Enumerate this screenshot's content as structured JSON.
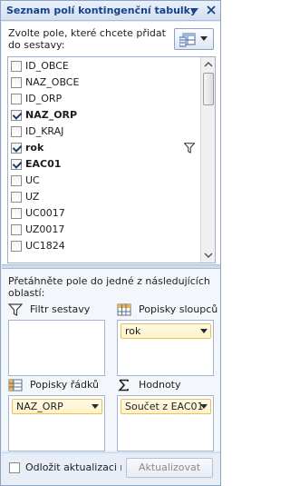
{
  "panel": {
    "title": "Seznam polí kontingenční tabulky"
  },
  "upper": {
    "instructions": "Zvolte pole, které chcete přidat do sestavy:",
    "layout_button_icon": "field-list-layout-icon"
  },
  "fields": [
    {
      "label": "ID_OBCE",
      "checked": false,
      "bold": false,
      "filtered": false
    },
    {
      "label": "NAZ_OBCE",
      "checked": false,
      "bold": false,
      "filtered": false
    },
    {
      "label": "ID_ORP",
      "checked": false,
      "bold": false,
      "filtered": false
    },
    {
      "label": "NAZ_ORP",
      "checked": true,
      "bold": true,
      "filtered": false
    },
    {
      "label": "ID_KRAJ",
      "checked": false,
      "bold": false,
      "filtered": false
    },
    {
      "label": "rok",
      "checked": true,
      "bold": true,
      "filtered": true
    },
    {
      "label": "EAC01",
      "checked": true,
      "bold": true,
      "filtered": false
    },
    {
      "label": "UC",
      "checked": false,
      "bold": false,
      "filtered": false
    },
    {
      "label": "UZ",
      "checked": false,
      "bold": false,
      "filtered": false
    },
    {
      "label": "UC0017",
      "checked": false,
      "bold": false,
      "filtered": false
    },
    {
      "label": "UZ0017",
      "checked": false,
      "bold": false,
      "filtered": false
    },
    {
      "label": "UC1824",
      "checked": false,
      "bold": false,
      "filtered": false
    }
  ],
  "lower": {
    "instructions": "Přetáhněte pole do jedné z následujících oblastí:",
    "areas": {
      "filter": {
        "label": "Filtr sestavy",
        "items": []
      },
      "columns": {
        "label": "Popisky sloupců",
        "items": [
          "rok"
        ]
      },
      "rows": {
        "label": "Popisky řádků",
        "items": [
          "NAZ_ORP"
        ]
      },
      "values": {
        "label": "Hodnoty",
        "items": [
          "Součet z EAC01"
        ]
      }
    }
  },
  "bottom": {
    "defer_label": "Odložit aktualizaci rozlo...",
    "update_button": "Aktualizovat"
  },
  "colors": {
    "title_text": "#15428b",
    "chip_border": "#e7c45a",
    "chip_fill": "#fff2c6",
    "pane_bg": "#e3ecf7"
  }
}
